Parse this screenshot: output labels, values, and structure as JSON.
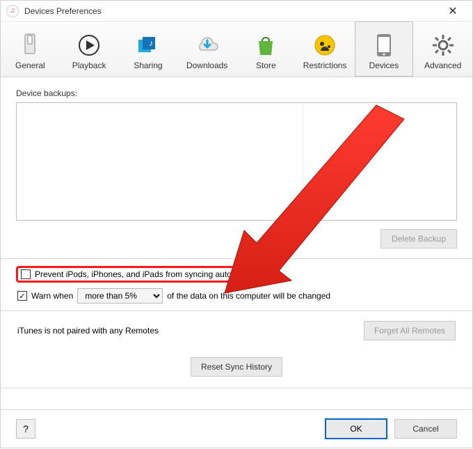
{
  "window": {
    "title": "Devices Preferences"
  },
  "tabs": {
    "general": "General",
    "playback": "Playback",
    "sharing": "Sharing",
    "downloads": "Downloads",
    "store": "Store",
    "restrictions": "Restrictions",
    "devices": "Devices",
    "advanced": "Advanced"
  },
  "backups": {
    "label": "Device backups:",
    "delete": "Delete Backup"
  },
  "options": {
    "prevent_sync": "Prevent iPods, iPhones, and iPads from syncing automatically",
    "warn_prefix": "Warn when",
    "warn_select": "more than 5%",
    "warn_suffix": "of the data on this computer will be changed"
  },
  "remotes": {
    "status": "iTunes is not paired with any Remotes",
    "forget": "Forget All Remotes"
  },
  "buttons": {
    "reset": "Reset Sync History",
    "ok": "OK",
    "cancel": "Cancel",
    "help": "?"
  }
}
